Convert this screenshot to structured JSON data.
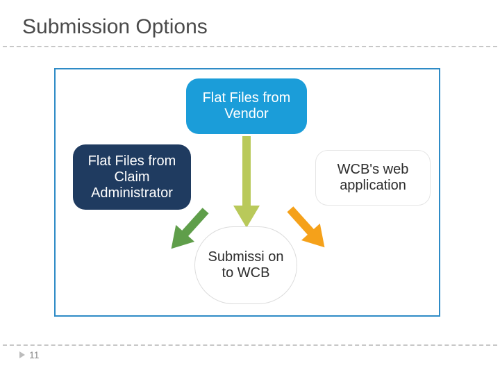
{
  "title": "Submission Options",
  "nodes": {
    "top": {
      "label": "Flat Files from Vendor",
      "bg": "#1b9dd9",
      "fg": "#ffffff"
    },
    "left": {
      "label": "Flat Files from Claim Administrator",
      "bg": "#1f3b60",
      "fg": "#ffffff"
    },
    "right": {
      "label": "WCB's web application",
      "bg": "#ffffff",
      "fg": "#2c2c2c"
    },
    "center": {
      "label": "Submissi on to WCB",
      "bg": "#ffffff",
      "fg": "#2c2c2c"
    }
  },
  "arrows": {
    "top_to_center": "#b9c95a",
    "left_to_center": "#5f9e4a",
    "right_to_center": "#f5a11a"
  },
  "page_number": "11"
}
